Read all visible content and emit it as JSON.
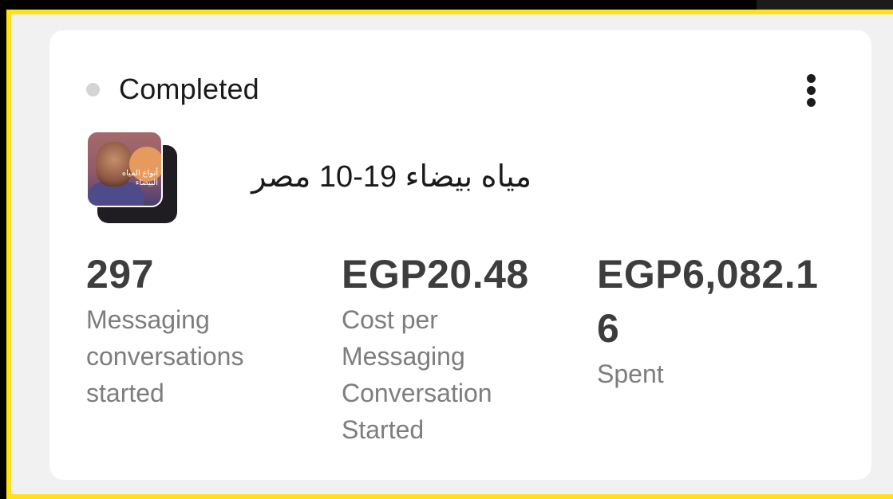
{
  "status": {
    "label": "Completed",
    "dot_color": "#d4d4d4"
  },
  "menu": {
    "icon": "more-vertical-icon"
  },
  "campaign": {
    "title": "مياه بيضاء 19-10 مصر",
    "thumbnail_text": "أنواع المياه البيضاء"
  },
  "metrics": [
    {
      "value": "297",
      "label": "Messaging conversations started"
    },
    {
      "value": "EGP20.48",
      "label": "Cost per Messaging Conversation Started"
    },
    {
      "value": "EGP6,082.16",
      "label": "Spent"
    }
  ],
  "colors": {
    "frame_border": "#ffe11a",
    "card_background": "#ffffff",
    "page_background": "#f1f1f1",
    "metric_value": "#3d3d3d",
    "metric_label": "#7d7d7d"
  }
}
